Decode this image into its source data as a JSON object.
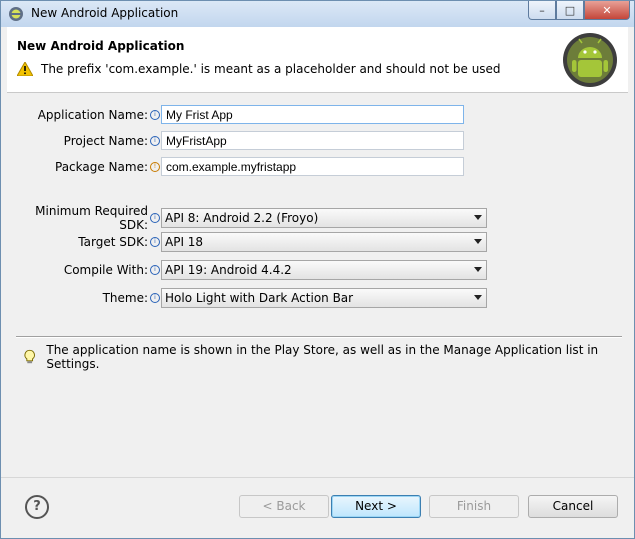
{
  "window": {
    "title": "New Android Application"
  },
  "header": {
    "title": "New Android Application",
    "warning": "The prefix 'com.example.' is meant as a placeholder and should not be used"
  },
  "form": {
    "application_name": {
      "label": "Application Name:",
      "value": "My Frist App"
    },
    "project_name": {
      "label": "Project Name:",
      "value": "MyFristApp"
    },
    "package_name": {
      "label": "Package Name:",
      "value": "com.example.myfristapp"
    },
    "min_sdk": {
      "label": "Minimum Required SDK:",
      "value": "API 8: Android 2.2 (Froyo)"
    },
    "target_sdk": {
      "label": "Target SDK:",
      "value": "API 18"
    },
    "compile_with": {
      "label": "Compile With:",
      "value": "API 19: Android 4.4.2"
    },
    "theme": {
      "label": "Theme:",
      "value": "Holo Light with Dark Action Bar"
    }
  },
  "hint": "The application name is shown in the Play Store, as well as in the Manage Application list in Settings.",
  "buttons": {
    "back": "< Back",
    "next": "Next >",
    "finish": "Finish",
    "cancel": "Cancel"
  },
  "icons": {
    "help": "?",
    "minimize": "–",
    "maximize": "□",
    "close": "✕"
  },
  "colors": {
    "titlebar": "#c2d6ee",
    "android_green": "#9fc03b",
    "warning": "#f2c200",
    "default_button": "#bee6fd"
  }
}
